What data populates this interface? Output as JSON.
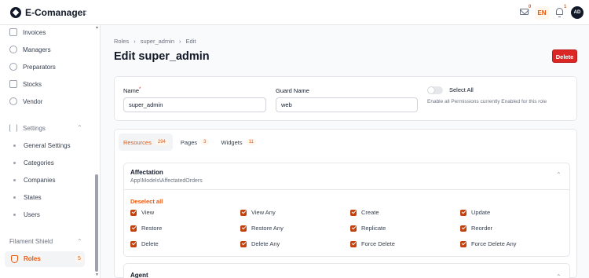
{
  "app": {
    "name": "E-Comanager",
    "collapse_icon": "chevron-left-icon"
  },
  "topbar": {
    "mail_count": "0",
    "language": "EN",
    "notifications_count": "1",
    "avatar_initials": "AD"
  },
  "sidebar": {
    "items": [
      {
        "label": "Invoices",
        "icon": "invoice-icon"
      },
      {
        "label": "Managers",
        "icon": "users-icon"
      },
      {
        "label": "Preparators",
        "icon": "user-group-icon"
      },
      {
        "label": "Stocks",
        "icon": "building-icon"
      },
      {
        "label": "Vendor",
        "icon": "user-icon"
      }
    ],
    "settings_group": {
      "label": "Settings",
      "icon": "sliders-icon",
      "items": [
        "General Settings",
        "Categories",
        "Companies",
        "States",
        "Users"
      ]
    },
    "shield_group": {
      "label": "Filament Shield",
      "active_item": "Roles",
      "active_badge": "5"
    }
  },
  "breadcrumb": [
    "Roles",
    "super_admin",
    "Edit"
  ],
  "page": {
    "title": "Edit super_admin",
    "delete_label": "Delete"
  },
  "form": {
    "name_label": "Name",
    "name_value": "super_admin",
    "guard_label": "Guard Name",
    "guard_value": "web",
    "select_all_label": "Select All",
    "select_all_help": "Enable all Permissions currently Enabled for this role"
  },
  "tabs": [
    {
      "label": "Resources",
      "count": "294",
      "active": true
    },
    {
      "label": "Pages",
      "count": "3",
      "active": false
    },
    {
      "label": "Widgets",
      "count": "11",
      "active": false
    }
  ],
  "resource": {
    "title": "Affectation",
    "model": "App\\Models\\AffectatedOrders",
    "deselect_label": "Deselect all",
    "permissions": [
      [
        "View",
        "View Any",
        "Create",
        "Update"
      ],
      [
        "Restore",
        "Restore Any",
        "Replicate",
        "Reorder"
      ],
      [
        "Delete",
        "Delete Any",
        "Force Delete",
        "Force Delete Any"
      ]
    ]
  },
  "next_resource": {
    "title": "Agent"
  },
  "colors": {
    "accent": "#ea580c",
    "danger": "#dc2626",
    "checkbox": "#c2410c"
  }
}
